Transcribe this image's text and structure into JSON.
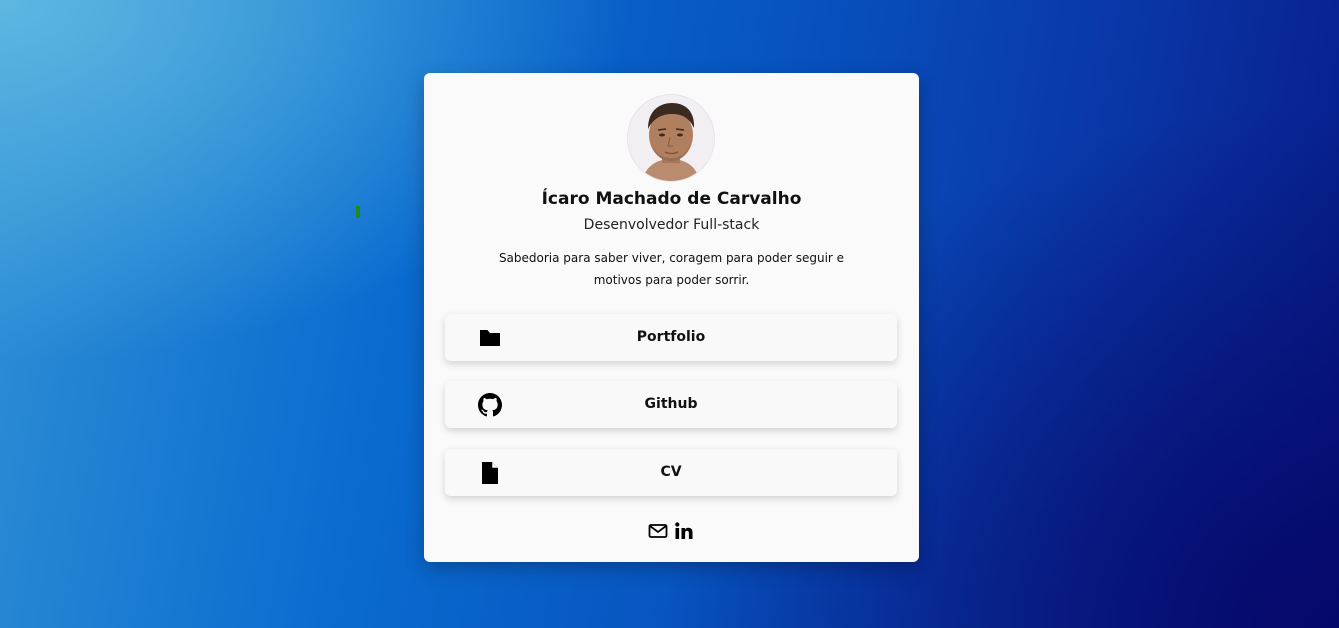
{
  "profile": {
    "name": "Ícaro Machado de Carvalho",
    "role": "Desenvolvedor Full-stack",
    "bio": "Sabedoria para saber viver, coragem para poder seguir e motivos para poder sorrir."
  },
  "links": {
    "portfolio": {
      "label": "Portfolio",
      "icon": "folder-icon"
    },
    "github": {
      "label": "Github",
      "icon": "github-icon"
    },
    "cv": {
      "label": "CV",
      "icon": "file-icon"
    }
  },
  "socials": [
    {
      "icon": "mail-icon"
    },
    {
      "icon": "linkedin-icon"
    }
  ],
  "colors": {
    "background_gradient_start": "#2f8fd6",
    "background_gradient_end": "#061a86",
    "card": "#fafafb",
    "text": "#111111"
  }
}
